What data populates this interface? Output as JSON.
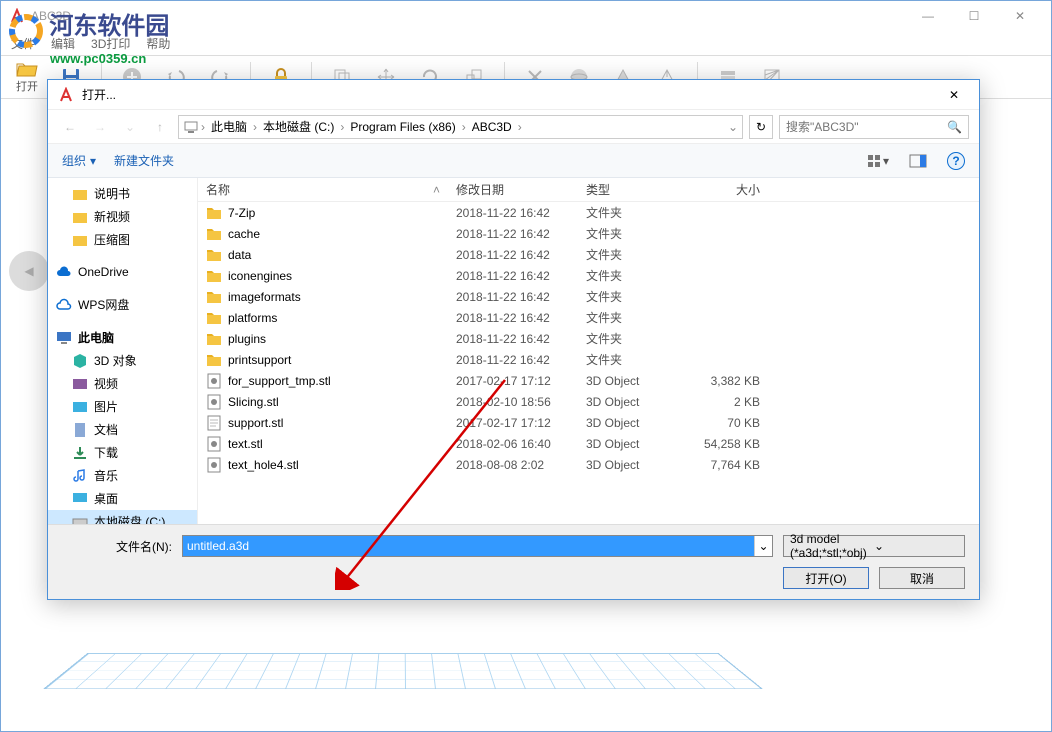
{
  "app": {
    "title": "ABC3D"
  },
  "watermark": {
    "cn": "河东软件园",
    "url": "www.pc0359.cn"
  },
  "menu": {
    "file": "文件",
    "edit": "编辑",
    "print3d": "3D打印",
    "help": "帮助"
  },
  "toolbar": {
    "open": "打开"
  },
  "dialog": {
    "title": "打开...",
    "crumbs": {
      "pc": "此电脑",
      "disk": "本地磁盘 (C:)",
      "pf": "Program Files (x86)",
      "app": "ABC3D"
    },
    "search_placeholder": "搜索\"ABC3D\"",
    "organize": "组织",
    "newfolder": "新建文件夹",
    "columns": {
      "name": "名称",
      "date": "修改日期",
      "type": "类型",
      "size": "大小"
    },
    "tree": {
      "manual": "说明书",
      "newvideo": "新视频",
      "compressed": "压缩图",
      "onedrive": "OneDrive",
      "wps": "WPS网盘",
      "thispc": "此电脑",
      "obj3d": "3D 对象",
      "video": "视频",
      "pictures": "图片",
      "docs": "文档",
      "downloads": "下载",
      "music": "音乐",
      "desktop": "桌面",
      "diskc": "本地磁盘 (C:)"
    },
    "files": [
      {
        "name": "7-Zip",
        "date": "2018-11-22 16:42",
        "type": "文件夹",
        "size": "",
        "icon": "folder"
      },
      {
        "name": "cache",
        "date": "2018-11-22 16:42",
        "type": "文件夹",
        "size": "",
        "icon": "folder"
      },
      {
        "name": "data",
        "date": "2018-11-22 16:42",
        "type": "文件夹",
        "size": "",
        "icon": "folder"
      },
      {
        "name": "iconengines",
        "date": "2018-11-22 16:42",
        "type": "文件夹",
        "size": "",
        "icon": "folder"
      },
      {
        "name": "imageformats",
        "date": "2018-11-22 16:42",
        "type": "文件夹",
        "size": "",
        "icon": "folder"
      },
      {
        "name": "platforms",
        "date": "2018-11-22 16:42",
        "type": "文件夹",
        "size": "",
        "icon": "folder"
      },
      {
        "name": "plugins",
        "date": "2018-11-22 16:42",
        "type": "文件夹",
        "size": "",
        "icon": "folder"
      },
      {
        "name": "printsupport",
        "date": "2018-11-22 16:42",
        "type": "文件夹",
        "size": "",
        "icon": "folder"
      },
      {
        "name": "for_support_tmp.stl",
        "date": "2017-02-17 17:12",
        "type": "3D Object",
        "size": "3,382 KB",
        "icon": "stl"
      },
      {
        "name": "Slicing.stl",
        "date": "2018-02-10 18:56",
        "type": "3D Object",
        "size": "2 KB",
        "icon": "stl"
      },
      {
        "name": "support.stl",
        "date": "2017-02-17 17:12",
        "type": "3D Object",
        "size": "70 KB",
        "icon": "file"
      },
      {
        "name": "text.stl",
        "date": "2018-02-06 16:40",
        "type": "3D Object",
        "size": "54,258 KB",
        "icon": "stl"
      },
      {
        "name": "text_hole4.stl",
        "date": "2018-08-08 2:02",
        "type": "3D Object",
        "size": "7,764 KB",
        "icon": "stl"
      }
    ],
    "filename_label": "文件名(N):",
    "filename_value": "untitled.a3d",
    "filter": "3d model  (*a3d;*stl;*obj)",
    "open_btn": "打开(O)",
    "cancel_btn": "取消"
  }
}
